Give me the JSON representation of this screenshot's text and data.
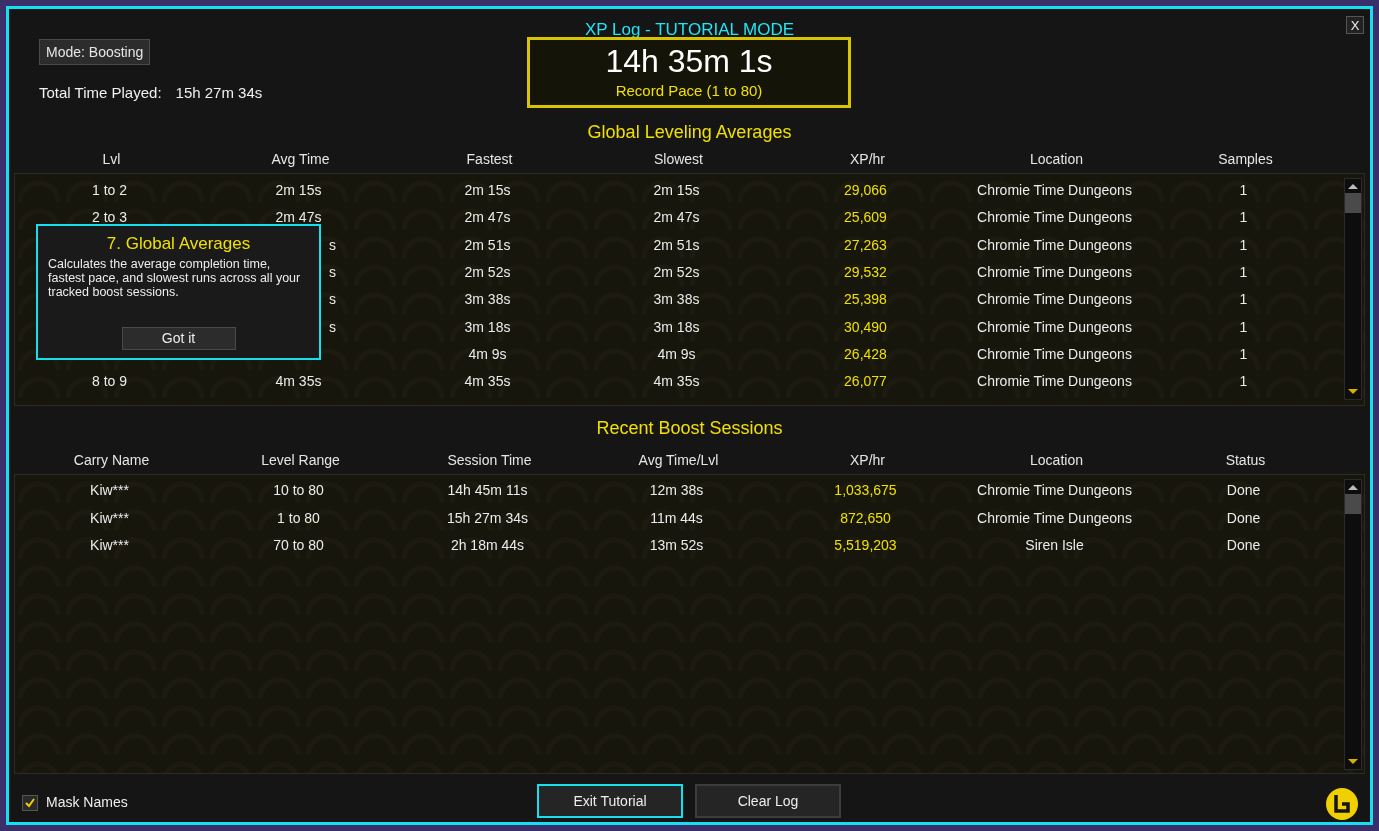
{
  "window": {
    "title": "XP Log - TUTORIAL MODE",
    "close_label": "X"
  },
  "mode_button": "Mode: Boosting",
  "total_time": {
    "label": "Total Time Played:",
    "value": "15h 27m 34s"
  },
  "record": {
    "time": "14h 35m 1s",
    "caption": "Record Pace (1 to 80)"
  },
  "averages": {
    "title": "Global Leveling Averages",
    "columns": [
      {
        "label": "Lvl",
        "highlight": false
      },
      {
        "label": "Avg Time",
        "highlight": false
      },
      {
        "label": "Fastest",
        "highlight": false
      },
      {
        "label": "Slowest",
        "highlight": false
      },
      {
        "label": "XP/hr",
        "highlight": true
      },
      {
        "label": "Location",
        "highlight": false
      },
      {
        "label": "Samples",
        "highlight": false
      }
    ],
    "rows": [
      {
        "covered": false,
        "cells": [
          "1 to 2",
          "2m 15s",
          "2m 15s",
          "2m 15s",
          "29,066",
          "Chromie Time Dungeons",
          "1"
        ]
      },
      {
        "covered": false,
        "cells": [
          "2 to 3",
          "2m 47s",
          "2m 47s",
          "2m 47s",
          "25,609",
          "Chromie Time Dungeons",
          "1"
        ]
      },
      {
        "covered": true,
        "cells": [
          null,
          "s",
          "2m 51s",
          "2m 51s",
          "27,263",
          "Chromie Time Dungeons",
          "1"
        ]
      },
      {
        "covered": true,
        "cells": [
          null,
          "s",
          "2m 52s",
          "2m 52s",
          "29,532",
          "Chromie Time Dungeons",
          "1"
        ]
      },
      {
        "covered": true,
        "cells": [
          null,
          "s",
          "3m 38s",
          "3m 38s",
          "25,398",
          "Chromie Time Dungeons",
          "1"
        ]
      },
      {
        "covered": true,
        "cells": [
          null,
          "s",
          "3m 18s",
          "3m 18s",
          "30,490",
          "Chromie Time Dungeons",
          "1"
        ]
      },
      {
        "cells": [
          null,
          null,
          "4m 9s",
          "4m 9s",
          "26,428",
          "Chromie Time Dungeons",
          "1"
        ]
      },
      {
        "covered": false,
        "cells": [
          "8 to 9",
          "4m 35s",
          "4m 35s",
          "4m 35s",
          "26,077",
          "Chromie Time Dungeons",
          "1"
        ]
      }
    ]
  },
  "tooltip": {
    "title": "7. Global Averages",
    "text": "Calculates the average completion time, fastest pace, and slowest runs across all your tracked boost sessions.",
    "button": "Got it"
  },
  "sessions": {
    "title": "Recent Boost Sessions",
    "columns": [
      {
        "label": "Carry Name",
        "highlight": false
      },
      {
        "label": "Level Range",
        "highlight": false
      },
      {
        "label": "Session Time",
        "highlight": false
      },
      {
        "label": "Avg Time/Lvl",
        "highlight": false
      },
      {
        "label": "XP/hr",
        "highlight": true
      },
      {
        "label": "Location",
        "highlight": false
      },
      {
        "label": "Status",
        "highlight": false
      }
    ],
    "rows": [
      {
        "cells": [
          "Kiw***",
          "10 to 80",
          "14h 45m 11s",
          "12m 38s",
          "1,033,675",
          "Chromie Time Dungeons",
          "Done"
        ]
      },
      {
        "cells": [
          "Kiw***",
          "1 to 80",
          "15h 27m 34s",
          "11m 44s",
          "872,650",
          "Chromie Time Dungeons",
          "Done"
        ]
      },
      {
        "cells": [
          "Kiw***",
          "70 to 80",
          "2h 18m 44s",
          "13m 52s",
          "5,519,203",
          "Siren Isle",
          "Done"
        ]
      }
    ]
  },
  "mask_names": {
    "label": "Mask Names",
    "checked": true
  },
  "buttons": [
    {
      "label": "Exit Tutorial",
      "highlighted": true
    },
    {
      "label": "Clear Log",
      "highlighted": false
    }
  ]
}
